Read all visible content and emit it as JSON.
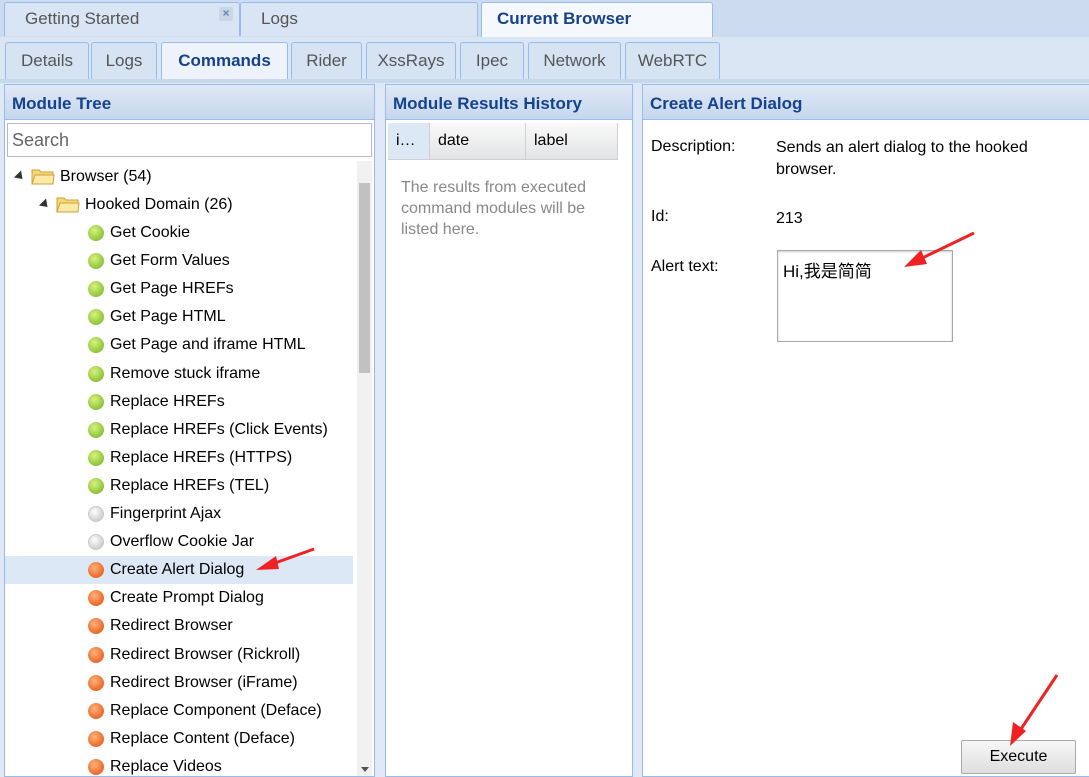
{
  "top_tabs": [
    {
      "label": "Getting Started"
    },
    {
      "label": "Logs"
    },
    {
      "label": "Current Browser"
    }
  ],
  "sub_tabs": [
    "Details",
    "Logs",
    "Commands",
    "Rider",
    "XssRays",
    "Ipec",
    "Network",
    "WebRTC"
  ],
  "module_tree": {
    "title": "Module Tree",
    "search_placeholder": "Search",
    "root": "Browser (54)",
    "folder": "Hooked Domain (26)",
    "items": [
      {
        "label": "Get Cookie",
        "status": "green"
      },
      {
        "label": "Get Form Values",
        "status": "green"
      },
      {
        "label": "Get Page HREFs",
        "status": "green"
      },
      {
        "label": "Get Page HTML",
        "status": "green"
      },
      {
        "label": "Get Page and iframe HTML",
        "status": "green"
      },
      {
        "label": "Remove stuck iframe",
        "status": "green"
      },
      {
        "label": "Replace HREFs",
        "status": "green"
      },
      {
        "label": "Replace HREFs (Click Events)",
        "status": "green"
      },
      {
        "label": "Replace HREFs (HTTPS)",
        "status": "green"
      },
      {
        "label": "Replace HREFs (TEL)",
        "status": "green"
      },
      {
        "label": "Fingerprint Ajax",
        "status": "grey"
      },
      {
        "label": "Overflow Cookie Jar",
        "status": "grey"
      },
      {
        "label": "Create Alert Dialog",
        "status": "orange",
        "selected": true
      },
      {
        "label": "Create Prompt Dialog",
        "status": "orange"
      },
      {
        "label": "Redirect Browser",
        "status": "orange"
      },
      {
        "label": "Redirect Browser (Rickroll)",
        "status": "orange"
      },
      {
        "label": "Redirect Browser (iFrame)",
        "status": "orange"
      },
      {
        "label": "Replace Component (Deface)",
        "status": "orange"
      },
      {
        "label": "Replace Content (Deface)",
        "status": "orange"
      },
      {
        "label": "Replace Videos",
        "status": "orange"
      }
    ]
  },
  "results": {
    "title": "Module Results History",
    "columns": [
      "i…",
      "date",
      "label"
    ],
    "empty_text": "The results from executed command modules will be listed here."
  },
  "command": {
    "title": "Create Alert Dialog",
    "description_label": "Description:",
    "description": "Sends an alert dialog to the hooked browser.",
    "id_label": "Id:",
    "id": "213",
    "alert_label": "Alert text:",
    "alert_value": "Hi,我是简简",
    "execute_label": "Execute"
  },
  "colors": {
    "accent": "#15428b",
    "annotation": "#ee2222"
  }
}
